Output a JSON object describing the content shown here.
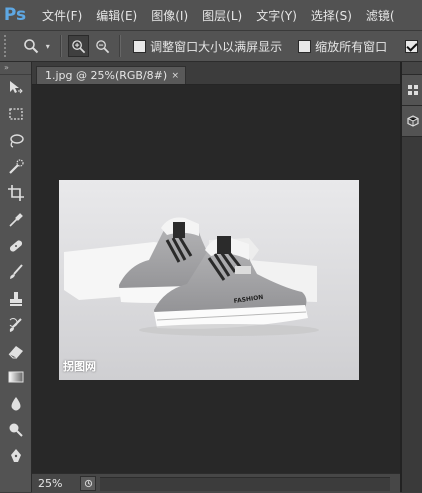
{
  "app": {
    "logo": "Ps",
    "menu": [
      "文件(F)",
      "编辑(E)",
      "图像(I)",
      "图层(L)",
      "文字(Y)",
      "选择(S)",
      "滤镜("
    ]
  },
  "options": {
    "tool_icon": "zoom-icon",
    "zoom_in_icon": "zoom-in-icon",
    "zoom_out_icon": "zoom-out-icon",
    "resize_windows_label": "调整窗口大小以满屏显示",
    "resize_windows_checked": false,
    "zoom_all_windows_label": "缩放所有窗口",
    "zoom_all_windows_checked": false,
    "third_checkbox_checked": true
  },
  "document": {
    "tab_title": "1.jpg @ 25%(RGB/8#)",
    "close_glyph": "×",
    "watermark": "拐图网"
  },
  "status": {
    "zoom": "25%"
  },
  "colors": {
    "ui_dark": "#282828",
    "ui_panel": "#535353",
    "ps_blue": "#5ea8e4"
  },
  "toolbar": {
    "tools": [
      "move-tool-icon",
      "marquee-tool-icon",
      "lasso-tool-icon",
      "quick-select-tool-icon",
      "crop-tool-icon",
      "eyedropper-tool-icon",
      "healing-brush-tool-icon",
      "brush-tool-icon",
      "clone-stamp-tool-icon",
      "history-brush-tool-icon",
      "eraser-tool-icon",
      "gradient-tool-icon",
      "blur-tool-icon",
      "dodge-tool-icon",
      "pen-tool-icon"
    ]
  }
}
